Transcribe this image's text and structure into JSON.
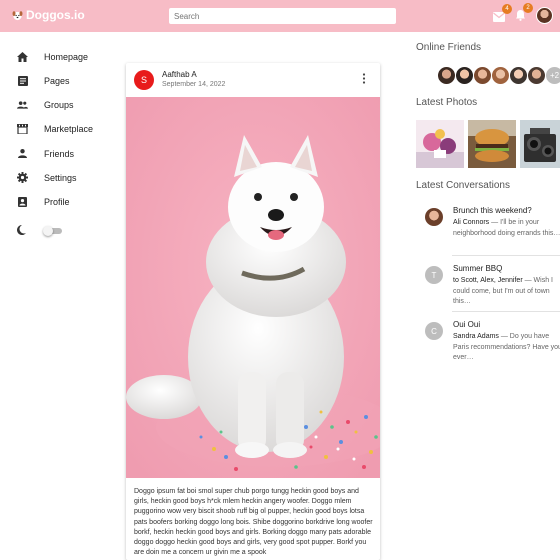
{
  "header": {
    "logo_text": "Doggos.io",
    "search_placeholder": "Search",
    "mail_badge": "4",
    "bell_badge": "2",
    "accent_color": "#f7bcc6"
  },
  "sidebar": {
    "items": [
      {
        "label": "Homepage",
        "icon": "home-icon"
      },
      {
        "label": "Pages",
        "icon": "pages-icon"
      },
      {
        "label": "Groups",
        "icon": "groups-icon"
      },
      {
        "label": "Marketplace",
        "icon": "store-icon"
      },
      {
        "label": "Friends",
        "icon": "person-icon"
      },
      {
        "label": "Settings",
        "icon": "gear-icon"
      },
      {
        "label": "Profile",
        "icon": "profile-icon"
      }
    ],
    "dark_mode_icon": "moon-icon"
  },
  "post": {
    "avatar_letter": "S",
    "author": "Aafthab A",
    "date": "September 14, 2022",
    "body": "Doggo ipsum fat boi smol super chub porgo tungg heckin good boys and girls, heckin good boys h*ck mlem heckin angery woofer. Doggo mlem puggorino wow very biscit shoob ruff big ol pupper, heckin good boys lotsa pats boofers borking doggo long bois. Shibe doggorino borkdrive long woofer borkf, heckin heckin good boys and girls. Borking doggo many pats adorable doggo doggo heckin good boys and girls, very good spot pupper. Borkf you are doin me a concern ur givin me a spook"
  },
  "right": {
    "online_friends_title": "Online Friends",
    "friends_more": "+2",
    "latest_photos_title": "Latest Photos",
    "latest_conversations_title": "Latest Conversations",
    "conversations": [
      {
        "avatar": "",
        "title": "Brunch this weekend?",
        "from": "Ali Connors",
        "text": " — I'll be in your neighborhood doing errands this…"
      },
      {
        "avatar": "T",
        "title": "Summer BBQ",
        "from": "to Scott, Alex, Jennifer",
        "text": " — Wish I could come, but I'm out of town this…"
      },
      {
        "avatar": "C",
        "title": "Oui Oui",
        "from": "Sandra Adams",
        "text": " — Do you have Paris recommendations? Have you ever…"
      }
    ]
  }
}
